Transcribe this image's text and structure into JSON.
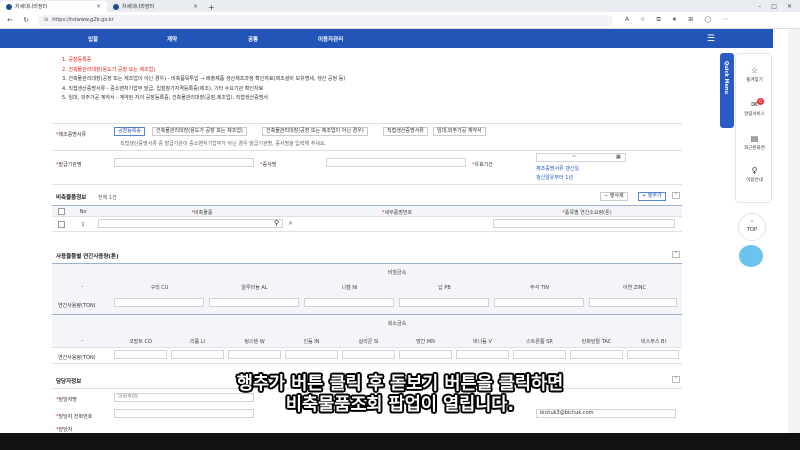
{
  "browser": {
    "tabs": [
      {
        "title": "차세대나라장터",
        "active": true
      },
      {
        "title": "차세대나라장터",
        "active": false
      }
    ],
    "new_tab": "+",
    "url": "https://tstwww.g2b.go.kr",
    "window_controls": [
      "–",
      "□",
      "✕"
    ]
  },
  "topnav": {
    "items": [
      "입찰",
      "계약",
      "공통",
      "이용자관리"
    ]
  },
  "notes": [
    {
      "text": "1. 공장등록증",
      "color": "red"
    },
    {
      "text": "2. 건축물관리대장(용도가 공장 또는 제조업)",
      "color": "red"
    },
    {
      "text": "3. 건축물관리대장(공장 또는 제조업이 아닌 경우) - 비축품목투입 → 배출제품 생산제조과정 확인자료(제조설비 보유명세, 생산 공정 등)",
      "color": "mixed"
    },
    {
      "text": "4. 직접생산증명서류 - 중소벤처기업부 발급, 입찰참가자격등록증(제조), 기타 수요기관 확인자료",
      "color": "mixed"
    },
    {
      "text": "5. 임대, 외주가공 계약서 - 계약된 자의 공장등록증, 건축물관리대장(공장,제조업), 직접생산증명서",
      "color": "mixed"
    }
  ],
  "proof": {
    "label": "제조증명서류",
    "options": [
      "공장등록증",
      "건축물관리대장(용도가 공장 또는 제조업)",
      "건축물관리대장(공장 또는 제조업이 아닌 경우)",
      "직접생산증명서류",
      "임대,외주가공 계약서"
    ],
    "hint": "직접생산증명서류 중 발급기관이 중소벤처기업부가 아닌 경우 발급기관명, 증서명을 입력해 주세요.",
    "issuer_label": "발급기관명",
    "cert_label": "증서명",
    "validity_label": "유효기간",
    "date_sep": "~",
    "link1": "제조증명서류 갱신일",
    "link2": "갱신알유부터 1년"
  },
  "stockpile": {
    "title": "비축물품정보",
    "count": "전체 1건",
    "delete_row": "행삭제",
    "add_row": "행추가",
    "headers": [
      "No",
      "비축물품",
      "세부품명번호",
      "품목별 연간소요량(톤)"
    ],
    "row_no": "1",
    "delete_x": "×"
  },
  "usage": {
    "title": "사용물품별 연간사용량(톤)",
    "nonferrous_title": "비철금속",
    "nonferrous": [
      "구리 CU",
      "알루미늄 AL",
      "니켈 NI",
      "납 PB",
      "주석 TIN",
      "아연 ZINC"
    ],
    "rare_title": "희소금속",
    "rare": [
      "코발트 CO",
      "리튬 LI",
      "텅스텐 W",
      "인듐 IN",
      "실리콘 SI",
      "망간 MN",
      "바나듐 V",
      "스트론튬 SR",
      "탄화탄탈 TAC",
      "비스무스 BI"
    ],
    "dash": "-",
    "row_label": "연간사용량(TON)"
  },
  "contact": {
    "title": "담당자정보",
    "name_label": "담당자명",
    "name_value": "이바주05",
    "phone_label": "담당자 전화번호",
    "extra_label": "담당자",
    "email_value": "bichuk3@bichuk.com"
  },
  "quick_menu": {
    "label": "Quick Menu",
    "items": [
      {
        "label": "즐겨찾기",
        "icon": "☆"
      },
      {
        "label": "알림서비스",
        "icon": "✉",
        "badge": "0"
      },
      {
        "label": "최근본화면",
        "icon": "▤"
      },
      {
        "label": "이용안내",
        "icon": "♀"
      }
    ],
    "top": "TOP",
    "top_arrow": "⌃"
  },
  "caption": {
    "line1": "행추가 버튼 클릭 후 돋보기 버튼을 클릭하면",
    "line2": "비축물품조회 팝업이 열립니다."
  }
}
